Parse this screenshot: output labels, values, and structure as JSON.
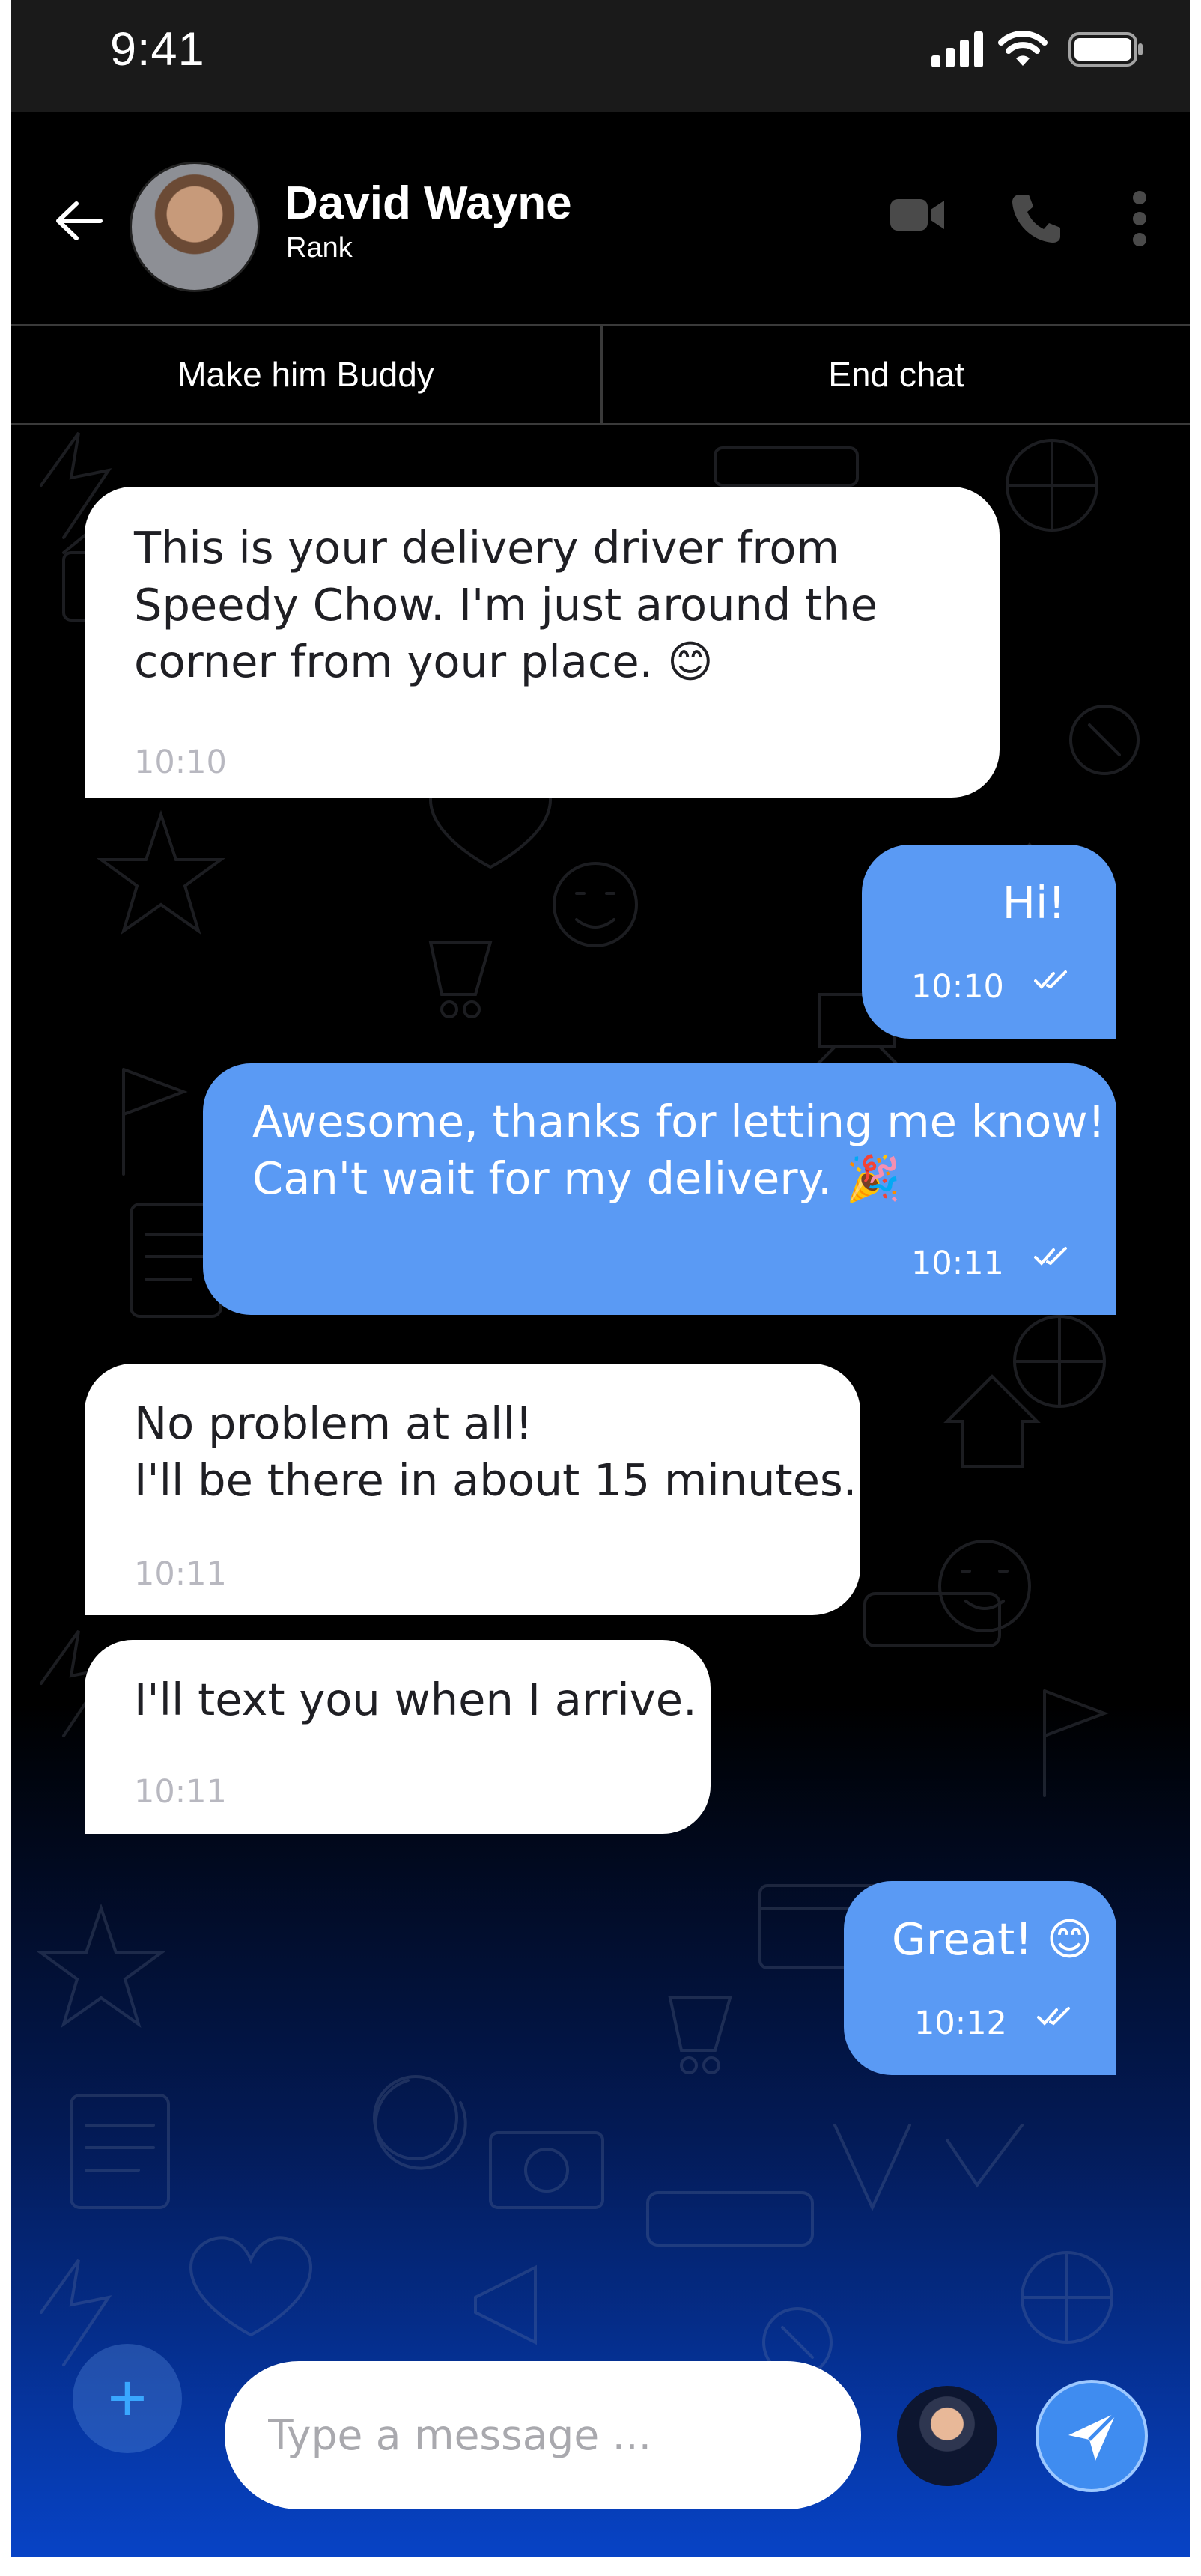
{
  "status_bar": {
    "time": "9:41"
  },
  "header": {
    "name": "David Wayne",
    "subtitle": "Rank",
    "icons": [
      "back-arrow-icon",
      "video-call-icon",
      "phone-icon",
      "more-vertical-icon"
    ]
  },
  "actions": {
    "make_buddy": "Make him Buddy",
    "end_chat": "End chat"
  },
  "messages": [
    {
      "dir": "in",
      "text": "This is your delivery driver from\nSpeedy Chow. I'm just around the\ncorner from your place. 😊",
      "time": "10:10"
    },
    {
      "dir": "out",
      "text": "Hi!",
      "time": "10:10",
      "status": "read"
    },
    {
      "dir": "out",
      "text": "Awesome, thanks for letting me know!\nCan't wait for my delivery. 🎉",
      "time": "10:11",
      "status": "read"
    },
    {
      "dir": "in",
      "text": "No problem at all!\nI'll be there in about 15 minutes.",
      "time": "10:11"
    },
    {
      "dir": "in",
      "text": "I'll text you when I arrive.",
      "time": "10:11"
    },
    {
      "dir": "out",
      "text": "Great! 😊",
      "time": "10:12",
      "status": "read"
    }
  ],
  "composer": {
    "placeholder": "Type a message ..."
  },
  "colors": {
    "outgoing_bubble": "#5a9af4",
    "incoming_bubble": "#ffffff",
    "background": "#000000",
    "accent": "#3f8cf0"
  }
}
